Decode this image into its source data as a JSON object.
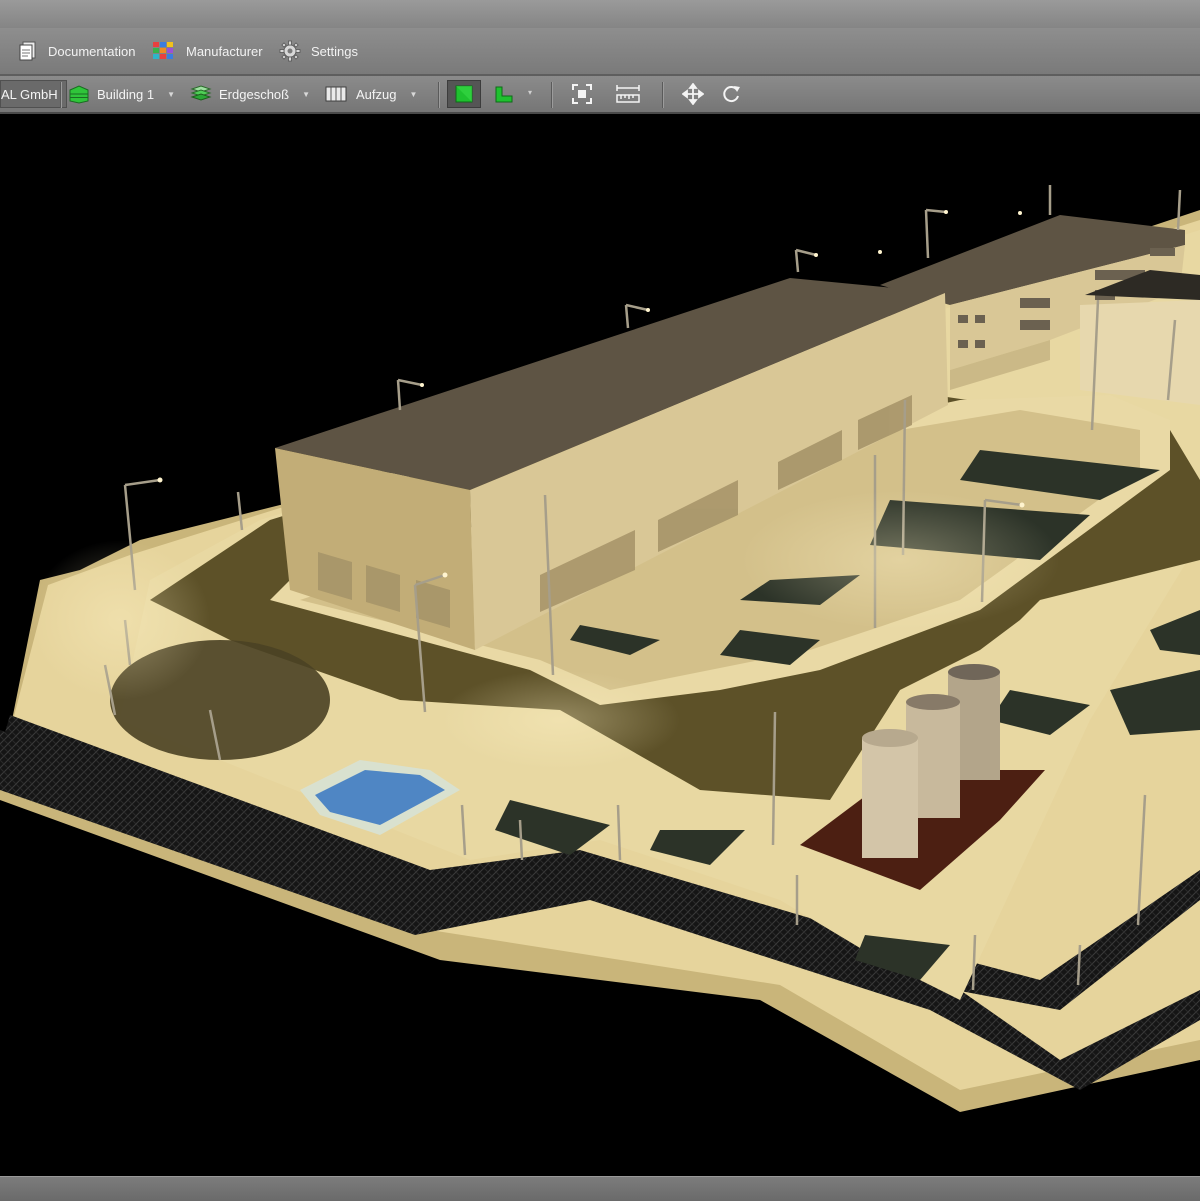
{
  "ribbon": {
    "items": [
      {
        "label": "Documentation",
        "icon": "documentation-icon"
      },
      {
        "label": "Manufacturer",
        "icon": "manufacturer-icon"
      },
      {
        "label": "Settings",
        "icon": "gear-icon"
      }
    ]
  },
  "toolbar": {
    "company": "AL GmbH",
    "building": "Building 1",
    "floor": "Erdgeschoß",
    "room": "Aufzug",
    "tools": [
      "3d-view-icon",
      "floor-plan-icon",
      "zoom-fit-icon",
      "measure-icon",
      "move-icon",
      "rotate-icon"
    ]
  },
  "colors": {
    "ui_gray": "#7e7e7e",
    "viewport_bg": "#000000",
    "ground_light": "#e9d79e",
    "grass": "#5b4f28",
    "building_light": "#d9c796",
    "roof": "#5e5444",
    "panel_green": "#2c3328",
    "water": "#4f86c4",
    "active_green": "#1fc12f"
  }
}
